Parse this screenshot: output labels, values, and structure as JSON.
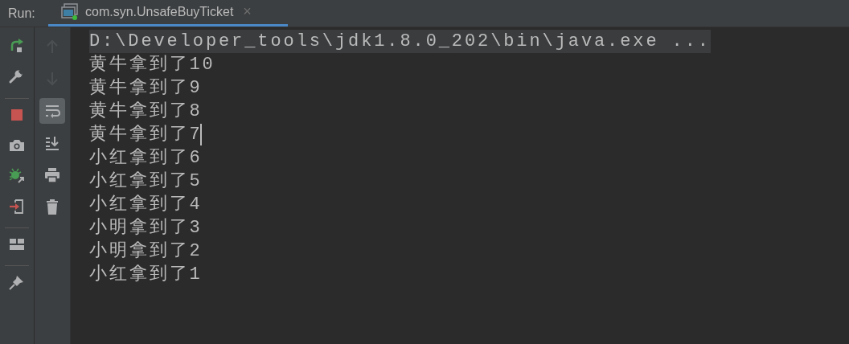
{
  "run_label": "Run:",
  "tab": {
    "title": "com.syn.UnsafeBuyTicket",
    "selected": true,
    "close": "×"
  },
  "left_toolbar": [
    {
      "kind": "rerun"
    },
    {
      "kind": "wrench"
    },
    {
      "kind": "separator"
    },
    {
      "kind": "stop"
    },
    {
      "kind": "camera"
    },
    {
      "kind": "debug"
    },
    {
      "kind": "exit"
    },
    {
      "kind": "separator"
    },
    {
      "kind": "layout"
    },
    {
      "kind": "separator"
    },
    {
      "kind": "pin"
    }
  ],
  "console_toolbar": [
    {
      "kind": "up",
      "disabled": true,
      "selected": false
    },
    {
      "kind": "down",
      "disabled": true,
      "selected": false
    },
    {
      "kind": "wrap",
      "disabled": false,
      "selected": true
    },
    {
      "kind": "scrollend",
      "disabled": false,
      "selected": false
    },
    {
      "kind": "print",
      "disabled": false,
      "selected": false
    },
    {
      "kind": "trash",
      "disabled": false,
      "selected": false
    }
  ],
  "console_lines": [
    {
      "text": "D:\\Developer_tools\\jdk1.8.0_202\\bin\\java.exe ...",
      "kind": "command",
      "cursor": false
    },
    {
      "text": "黄牛拿到了10",
      "kind": "output",
      "cursor": false
    },
    {
      "text": "黄牛拿到了9",
      "kind": "output",
      "cursor": false
    },
    {
      "text": "黄牛拿到了8",
      "kind": "output",
      "cursor": false
    },
    {
      "text": "黄牛拿到了7",
      "kind": "output",
      "cursor": true
    },
    {
      "text": "小红拿到了6",
      "kind": "output",
      "cursor": false
    },
    {
      "text": "小红拿到了5",
      "kind": "output",
      "cursor": false
    },
    {
      "text": "小红拿到了4",
      "kind": "output",
      "cursor": false
    },
    {
      "text": "小明拿到了3",
      "kind": "output",
      "cursor": false
    },
    {
      "text": "小明拿到了2",
      "kind": "output",
      "cursor": false
    },
    {
      "text": "小红拿到了1",
      "kind": "output",
      "cursor": false
    }
  ]
}
